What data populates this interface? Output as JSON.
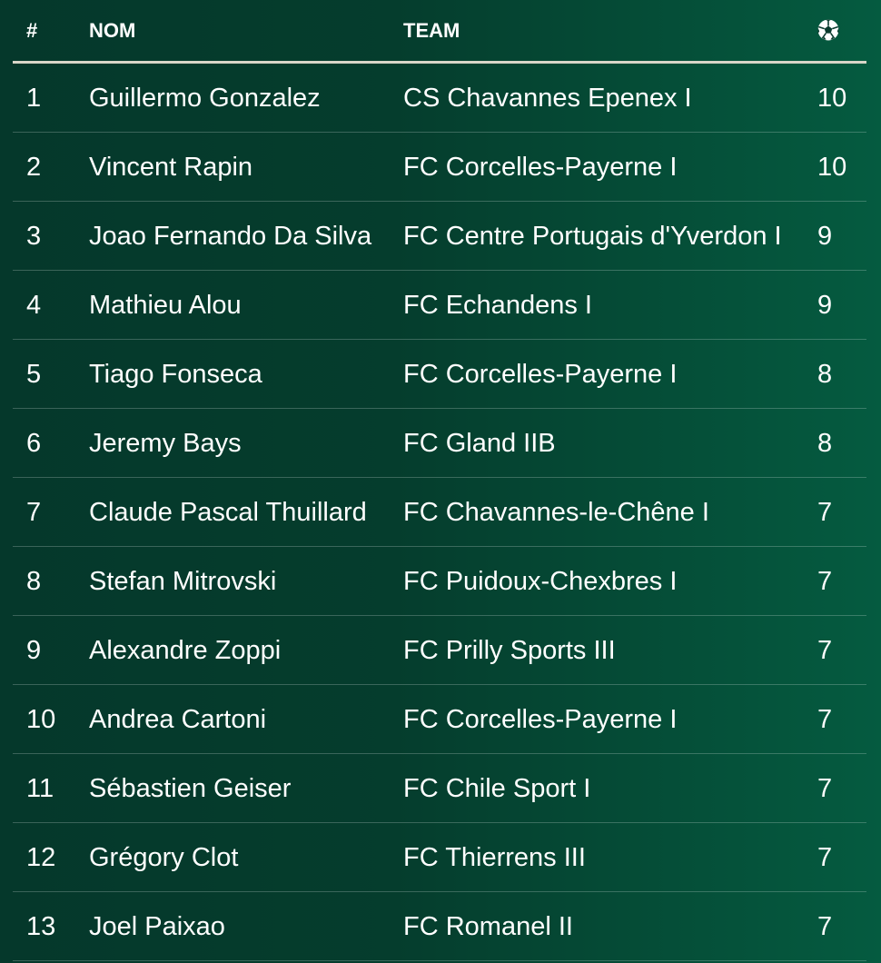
{
  "header": {
    "rank": "#",
    "name": "NOM",
    "team": "TEAM",
    "goals_icon": "soccer-ball-icon"
  },
  "rows": [
    {
      "rank": "1",
      "name": "Guillermo Gonzalez",
      "team": "CS Chavannes Epenex I",
      "goals": "10"
    },
    {
      "rank": "2",
      "name": "Vincent Rapin",
      "team": "FC Corcelles-Payerne I",
      "goals": "10"
    },
    {
      "rank": "3",
      "name": "Joao Fernando Da Silva",
      "team": "FC Centre Portugais d'Yverdon I",
      "goals": "9"
    },
    {
      "rank": "4",
      "name": "Mathieu Alou",
      "team": "FC Echandens I",
      "goals": "9"
    },
    {
      "rank": "5",
      "name": "Tiago Fonseca",
      "team": "FC Corcelles-Payerne I",
      "goals": "8"
    },
    {
      "rank": "6",
      "name": "Jeremy Bays",
      "team": "FC Gland IIB",
      "goals": "8"
    },
    {
      "rank": "7",
      "name": "Claude Pascal Thuillard",
      "team": "FC Chavannes-le-Chêne I",
      "goals": "7"
    },
    {
      "rank": "8",
      "name": "Stefan Mitrovski",
      "team": "FC Puidoux-Chexbres I",
      "goals": "7"
    },
    {
      "rank": "9",
      "name": "Alexandre Zoppi",
      "team": "FC Prilly Sports III",
      "goals": "7"
    },
    {
      "rank": "10",
      "name": "Andrea Cartoni",
      "team": "FC Corcelles-Payerne I",
      "goals": "7"
    },
    {
      "rank": "11",
      "name": "Sébastien Geiser",
      "team": "FC Chile Sport I",
      "goals": "7"
    },
    {
      "rank": "12",
      "name": "Grégory Clot",
      "team": "FC Thierrens III",
      "goals": "7"
    },
    {
      "rank": "13",
      "name": "Joel Paixao",
      "team": "FC Romanel II",
      "goals": "7"
    }
  ]
}
